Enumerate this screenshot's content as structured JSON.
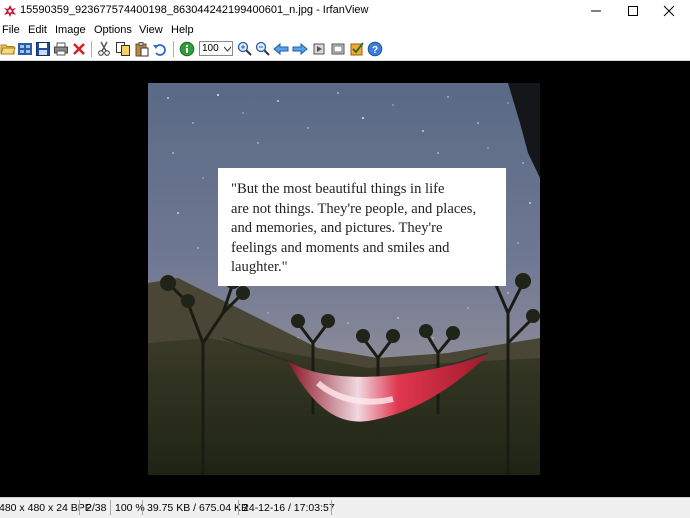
{
  "window": {
    "title": "15590359_923677574400198_863044242199400601_n.jpg - IrfanView"
  },
  "menu": [
    "File",
    "Edit",
    "Image",
    "Options",
    "View",
    "Help"
  ],
  "toolbar": {
    "zoom_value": "100",
    "icons": [
      "open-folder-icon",
      "thumbnails-icon",
      "save-icon",
      "print-icon",
      "delete-icon",
      "cut-icon",
      "copy-icon",
      "paste-icon",
      "undo-icon",
      "info-icon",
      "zoom-in-icon",
      "zoom-out-icon",
      "previous-icon",
      "next-icon",
      "slideshow-icon",
      "fullscreen-icon",
      "settings-icon",
      "help-icon"
    ]
  },
  "image": {
    "quote_lines": [
      "\"But the most beautiful things in life",
      "are not things. They're people, and places,",
      "and memories, and pictures. They're",
      "feelings and moments and smiles and",
      "laughter.\""
    ]
  },
  "status": {
    "dimensions": "480 x 480 x 24 BPP",
    "index": "2/38",
    "zoom": "100 %",
    "filesize": "39.75 KB / 675.04 KB",
    "datetime": "24-12-16 / 17:03:57"
  },
  "colors": {
    "viewer_background": "#000000",
    "hammock": "#d22a3c"
  }
}
